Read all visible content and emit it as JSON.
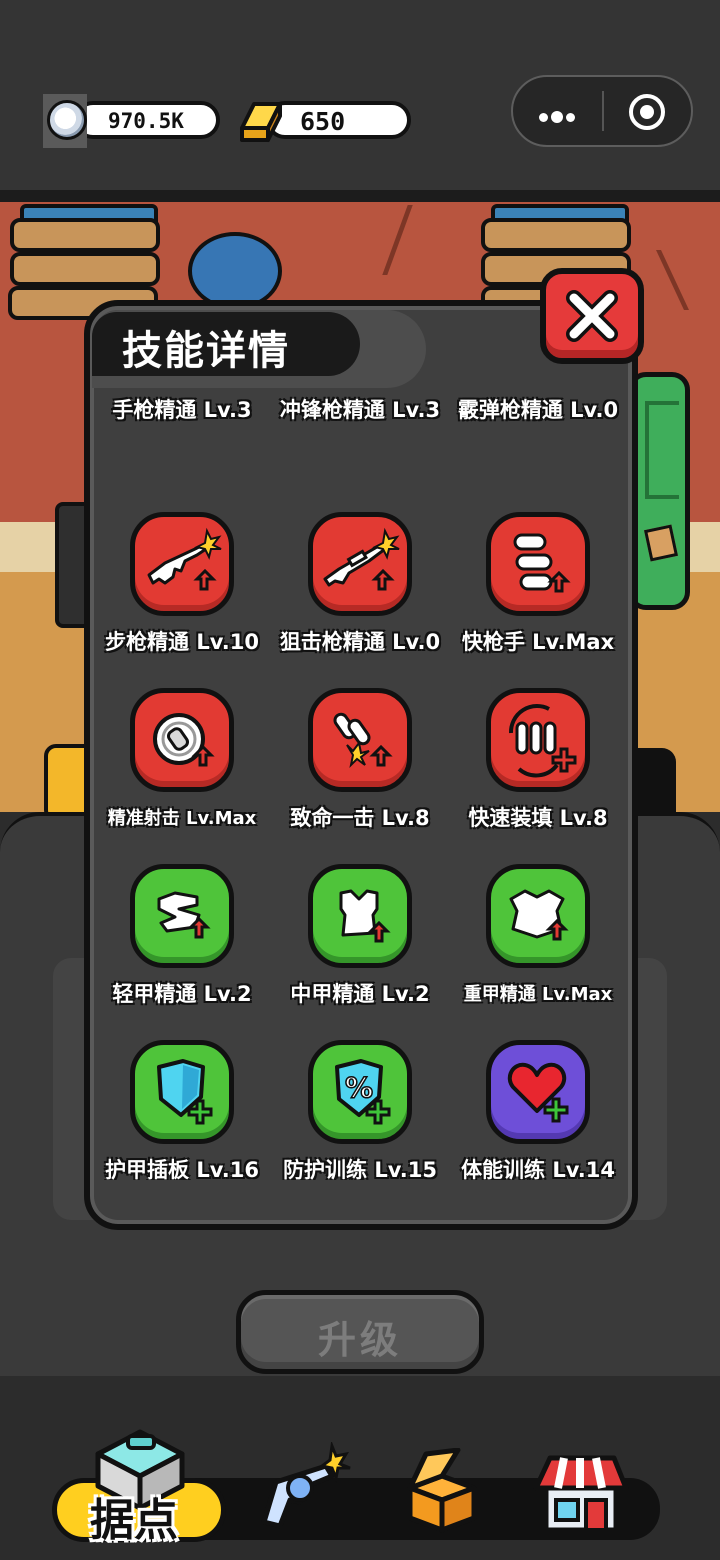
{
  "currency": {
    "silver": "970.5K",
    "gold": "650"
  },
  "dialog": {
    "title": "技能详情",
    "close_icon": "close-icon"
  },
  "skills": [
    {
      "label": "手枪精通 Lv.3",
      "color": "red",
      "icon": "pistol-icon"
    },
    {
      "label": "冲锋枪精通 Lv.3",
      "color": "red",
      "icon": "smg-icon"
    },
    {
      "label": "霰弹枪精通 Lv.0",
      "color": "red",
      "icon": "shotgun-icon"
    },
    {
      "label": "步枪精通 Lv.10",
      "color": "red",
      "icon": "rifle-icon"
    },
    {
      "label": "狙击枪精通 Lv.0",
      "color": "red",
      "icon": "sniper-icon"
    },
    {
      "label": "快枪手 Lv.Max",
      "color": "red",
      "icon": "bullets-icon"
    },
    {
      "label": "精准射击 Lv.Max",
      "color": "red",
      "icon": "crosshair-icon"
    },
    {
      "label": "致命一击 Lv.8",
      "color": "red",
      "icon": "critical-icon"
    },
    {
      "label": "快速装填 Lv.8",
      "color": "red",
      "icon": "reload-icon"
    },
    {
      "label": "轻甲精通 Lv.2",
      "color": "green",
      "icon": "light-armor-icon"
    },
    {
      "label": "中甲精通 Lv.2",
      "color": "green",
      "icon": "medium-armor-icon"
    },
    {
      "label": "重甲精通 Lv.Max",
      "color": "green",
      "icon": "heavy-armor-icon"
    },
    {
      "label": "护甲插板 Lv.16",
      "color": "green",
      "icon": "shield-plus-icon"
    },
    {
      "label": "防护训练 Lv.15",
      "color": "green",
      "icon": "shield-percent-icon"
    },
    {
      "label": "体能训练 Lv.14",
      "color": "purple",
      "icon": "heart-plus-icon"
    }
  ],
  "upgrade_button": {
    "label": "升级"
  },
  "nav": {
    "active_label": "据点",
    "items": [
      "base-icon",
      "revolver-icon",
      "crate-icon",
      "shop-icon"
    ]
  },
  "colors": {
    "skill_red": "#e23a33",
    "skill_green": "#4fc43a",
    "skill_purple": "#6e4fd8",
    "close_red": "#e53a3a",
    "nav_active": "#ffcf1f"
  }
}
